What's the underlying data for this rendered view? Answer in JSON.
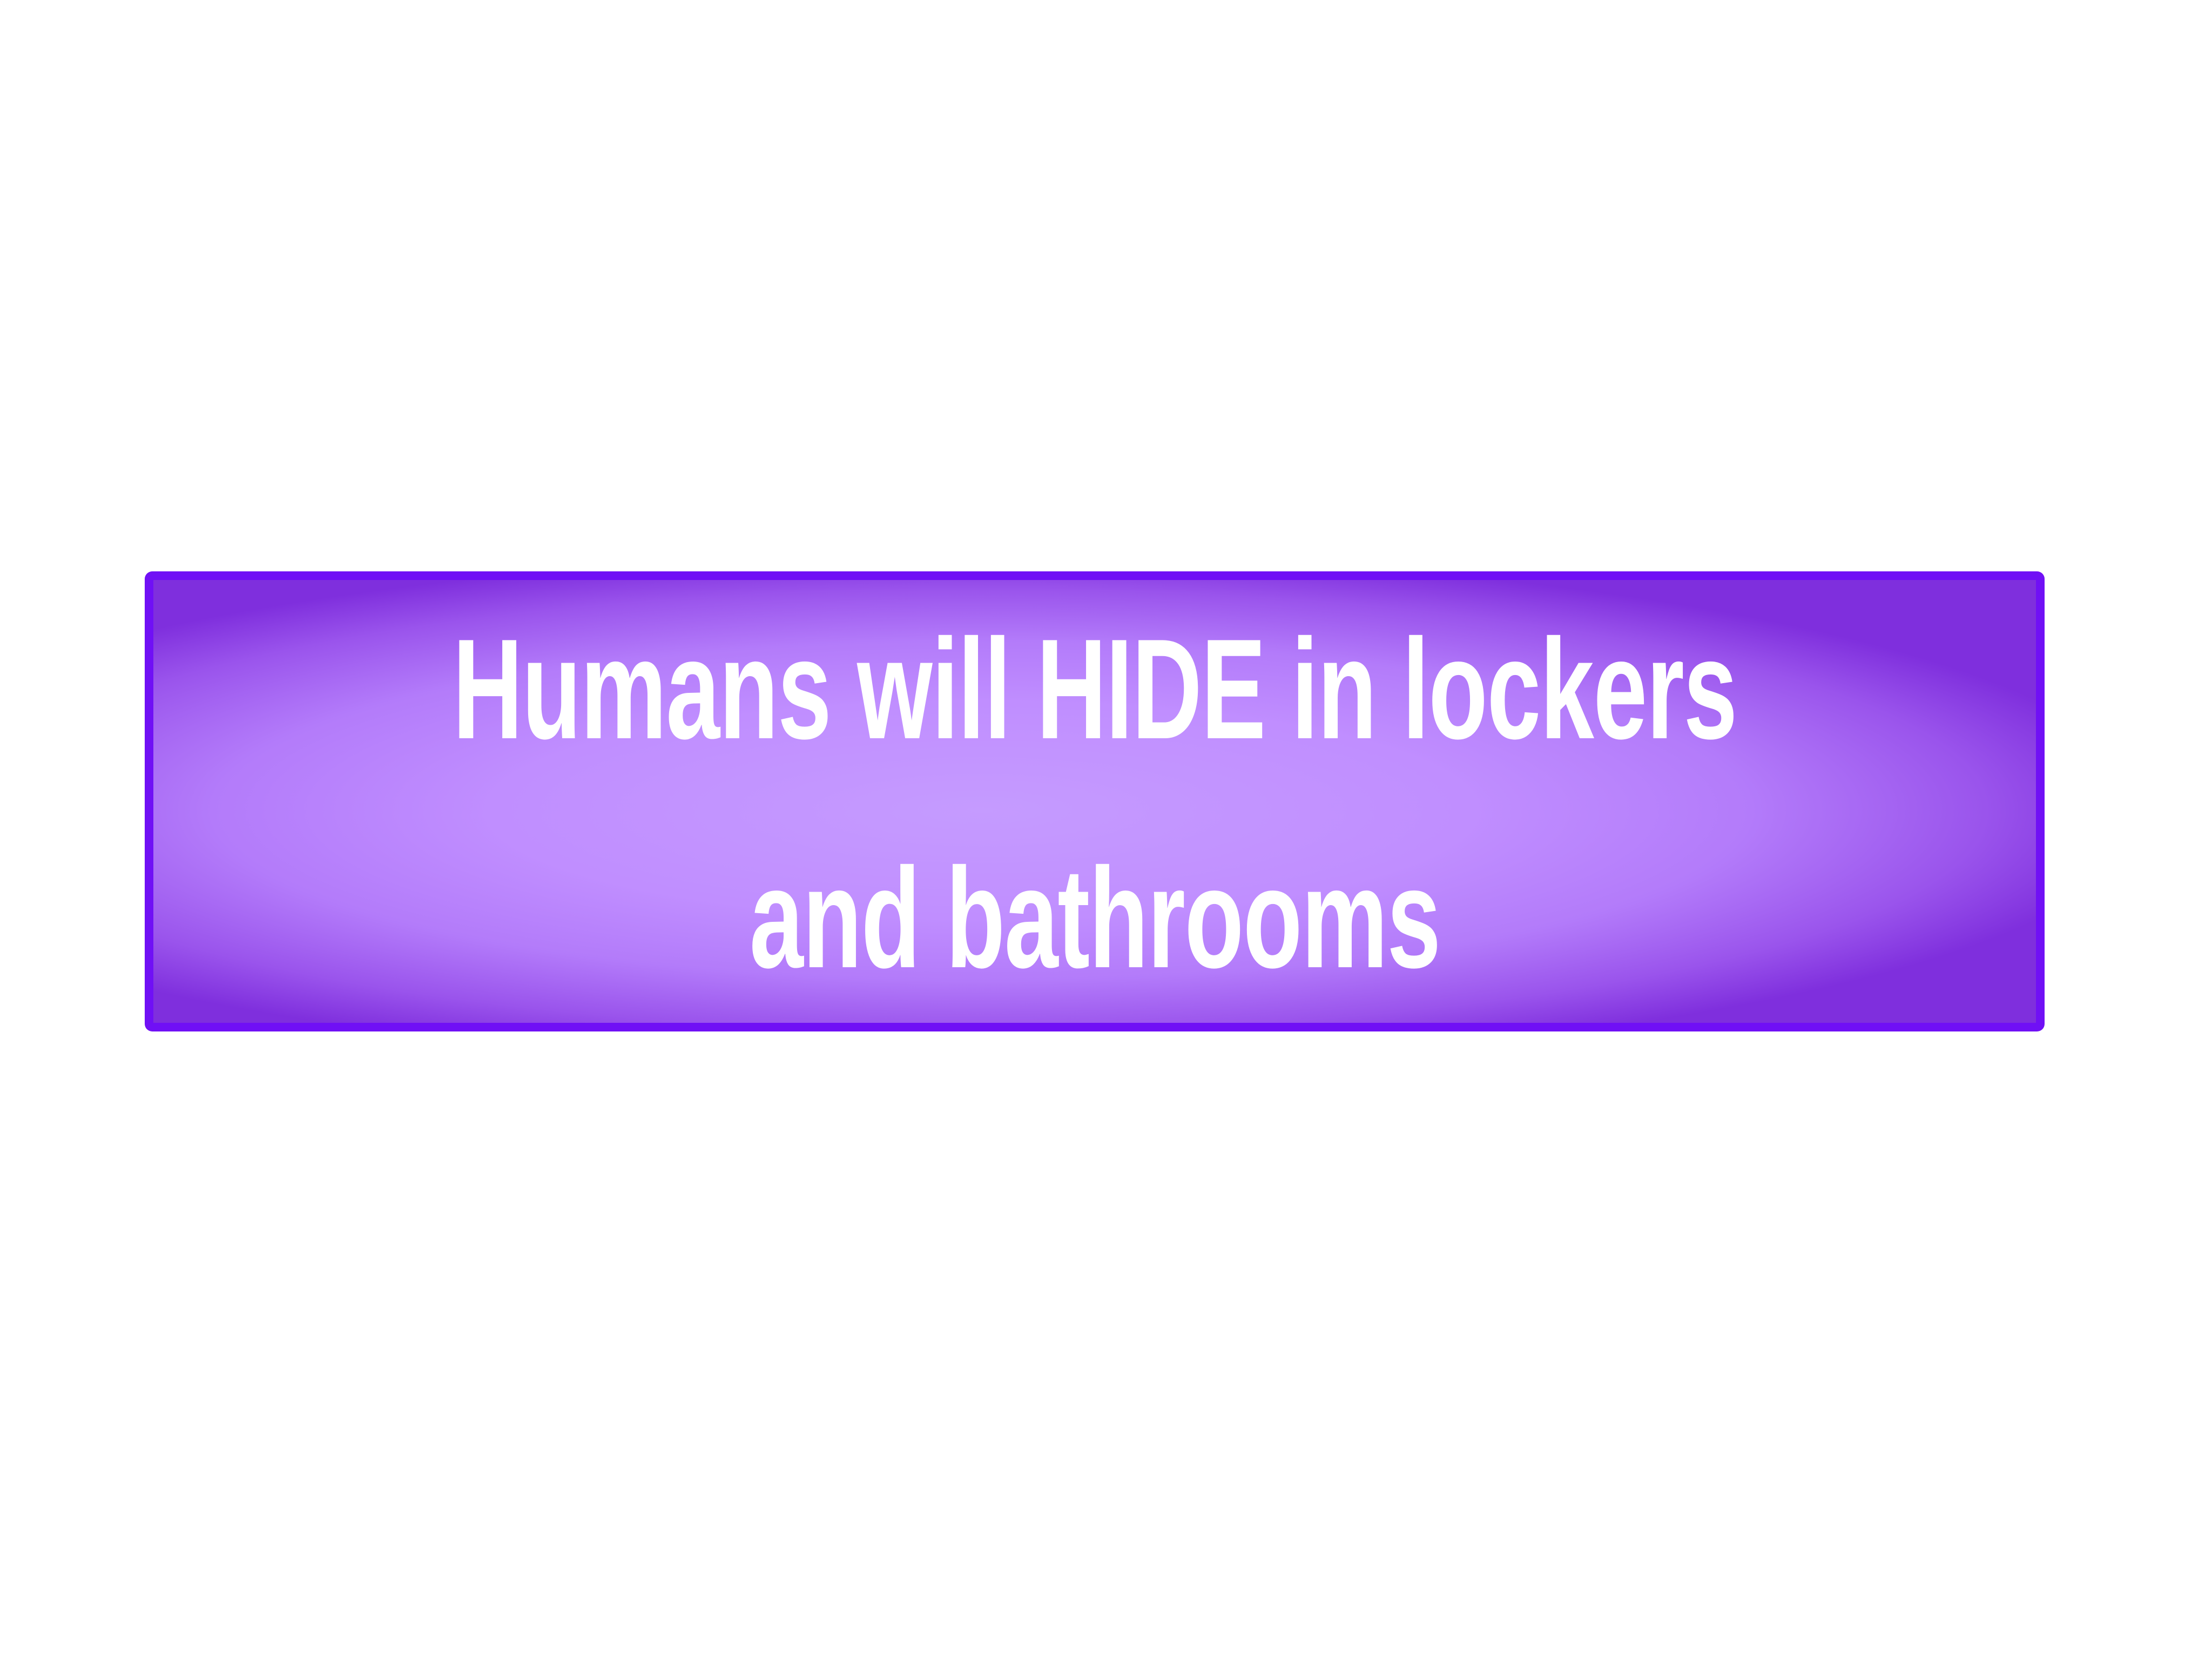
{
  "banner": {
    "line1": "Humans will HIDE in lockers",
    "line2": "and bathrooms"
  },
  "colors": {
    "background": "#ffffff",
    "banner_border": "#7010f5",
    "banner_fill_center": "#c59bff",
    "banner_fill_edge": "#7f2fdd",
    "text": "#ffffff"
  }
}
